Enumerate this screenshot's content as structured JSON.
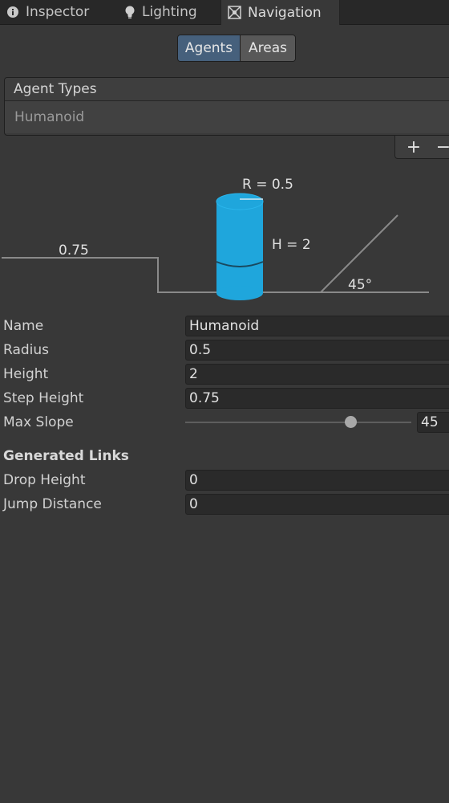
{
  "tabs": [
    {
      "label": "Inspector",
      "icon": "info-icon"
    },
    {
      "label": "Lighting",
      "icon": "lightbulb-icon"
    },
    {
      "label": "Navigation",
      "icon": "navmesh-icon",
      "active": true
    }
  ],
  "toggle": {
    "agents": "Agents",
    "areas": "Areas",
    "selected": "Agents"
  },
  "agent_types": {
    "header": "Agent Types",
    "items": [
      "Humanoid"
    ],
    "add_label": "+",
    "remove_label": "−"
  },
  "diagram": {
    "radius_label": "R = 0.5",
    "height_label": "H = 2",
    "step_label": "0.75",
    "slope_label": "45°",
    "cylinder_color": "#1fa6dc",
    "line_color": "#8a8a8a"
  },
  "properties": {
    "name": {
      "label": "Name",
      "value": "Humanoid"
    },
    "radius": {
      "label": "Radius",
      "value": "0.5"
    },
    "height": {
      "label": "Height",
      "value": "2"
    },
    "step_height": {
      "label": "Step Height",
      "value": "0.75"
    },
    "max_slope": {
      "label": "Max Slope",
      "value": "45",
      "slider_min": 0,
      "slider_max": 60,
      "slider_value": 45
    }
  },
  "generated_links": {
    "title": "Generated Links",
    "drop_height": {
      "label": "Drop Height",
      "value": "0"
    },
    "jump_distance": {
      "label": "Jump Distance",
      "value": "0"
    }
  },
  "colors": {
    "background": "#383838",
    "tabbar": "#282828",
    "accent": "#46607c",
    "field": "#2a2a2a"
  }
}
